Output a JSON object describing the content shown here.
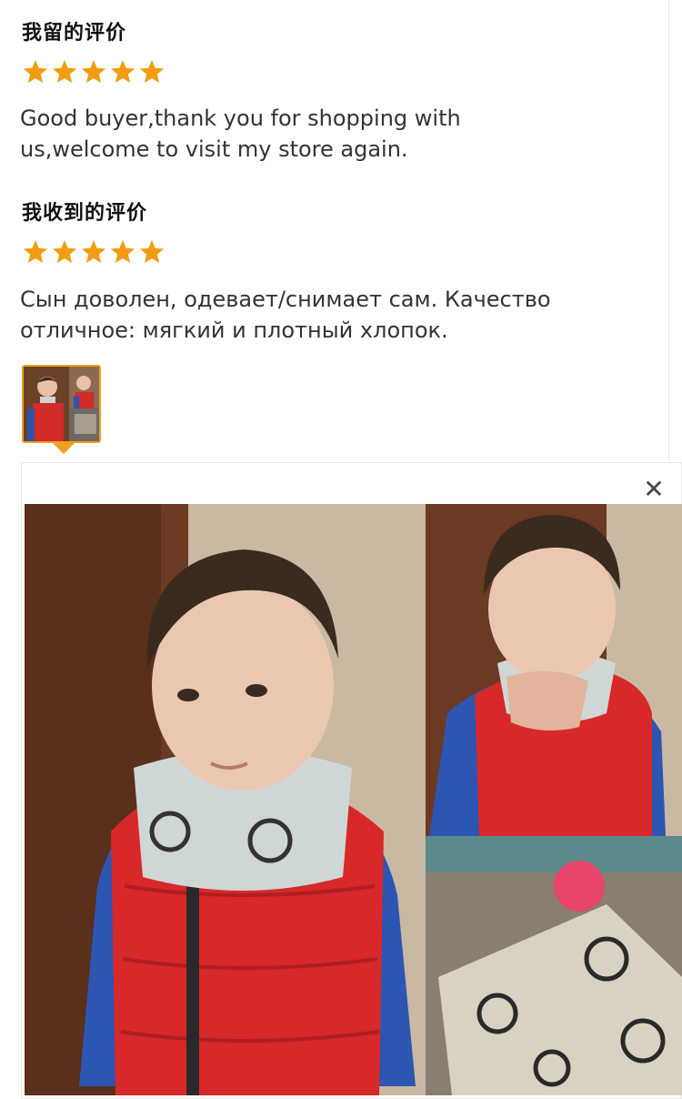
{
  "my_review": {
    "title": "我留的评价",
    "stars": 5,
    "text_line1": "Good buyer,thank you for shopping with",
    "text_line2": "us,welcome to visit my store again."
  },
  "received_review": {
    "title": "我收到的评价",
    "stars": 5,
    "text_line1": "Сын доволен, одевает/снимает сам. Качество",
    "text_line2": "отличное: мягкий и плотный хлопок."
  },
  "viewer": {
    "close_icon": "close-icon"
  },
  "colors": {
    "star": "#f39c12",
    "thumb_border": "#f0a020"
  }
}
